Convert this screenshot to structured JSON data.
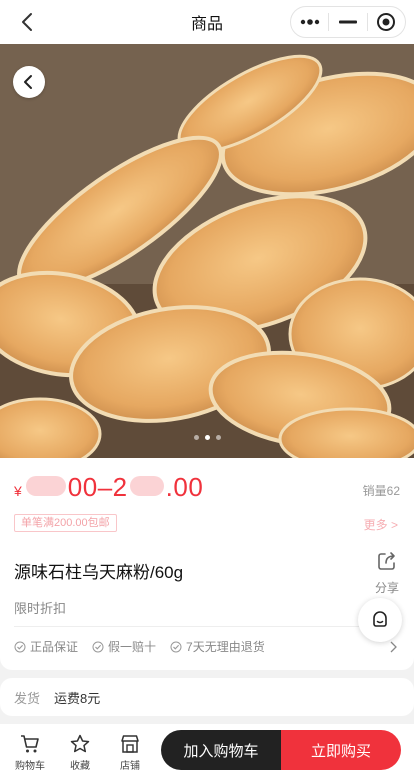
{
  "navbar": {
    "title": "商品",
    "back_icon": "chevron-left-icon",
    "menu_icons": [
      "more-dots-icon",
      "minimize-icon",
      "close-target-icon"
    ]
  },
  "hero": {
    "back_icon": "chevron-left-icon",
    "slide_count": 3,
    "active_slide": 2
  },
  "product": {
    "currency": "¥",
    "price_fragment_1": "00–2",
    "price_fragment_2": ".00",
    "sales": "销量62",
    "promo": "单笔满200.00包邮",
    "promo_more": "更多 >",
    "title": "源味石柱乌天麻粉/60g",
    "share_label": "分享",
    "discount": "限时折扣",
    "guarantees": [
      "正品保证",
      "假一赔十",
      "7天无理由退货"
    ]
  },
  "shipping": {
    "label": "发货",
    "value": "运费8元"
  },
  "bottom": {
    "tabs": [
      {
        "label": "购物车",
        "icon": "cart-icon"
      },
      {
        "label": "收藏",
        "icon": "star-icon"
      },
      {
        "label": "店铺",
        "icon": "store-icon"
      }
    ],
    "add_to_cart": "加入购物车",
    "buy_now": "立即购买"
  },
  "colors": {
    "accent": "#f0323c",
    "dark": "#222222"
  }
}
